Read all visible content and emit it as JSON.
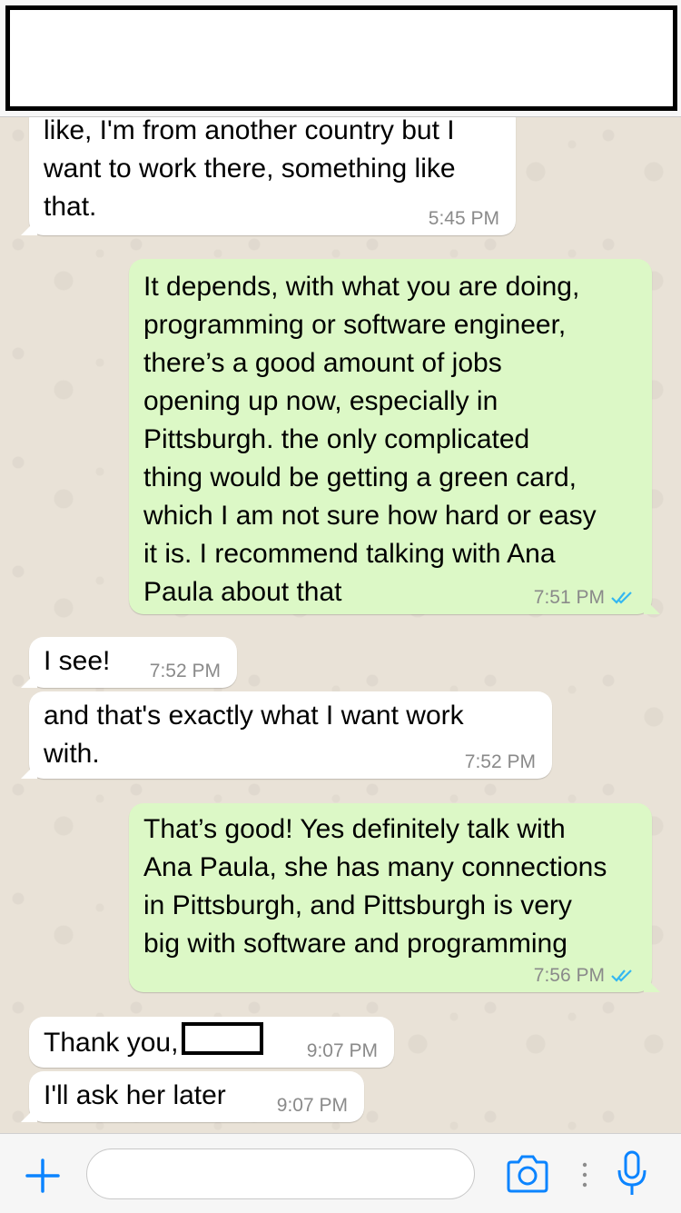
{
  "colors": {
    "accent": "#0b84ff",
    "incoming_bubble": "#ffffff",
    "outgoing_bubble": "#dcf8c6",
    "timestamp": "#8a8a8a",
    "read_ticks": "#34b7f1"
  },
  "messages": [
    {
      "direction": "incoming",
      "text": "like, I'm from another country but I\nwant to work there, something like\nthat.",
      "time": "5:45 PM"
    },
    {
      "direction": "outgoing",
      "text": "It depends, with what you are doing,\nprogramming or software engineer,\nthere’s a good amount of jobs\nopening up now, especially in\nPittsburgh. the only complicated\nthing would be getting a green card,\nwhich I am not sure how hard or easy\nit is. I recommend talking with Ana\nPaula about that",
      "time": "7:51 PM",
      "status": "read"
    },
    {
      "direction": "incoming",
      "text": "I see!",
      "time": "7:52 PM"
    },
    {
      "direction": "incoming",
      "text": "and that's exactly what I want work\nwith.",
      "time": "7:52 PM"
    },
    {
      "direction": "outgoing",
      "text": "That’s good! Yes definitely talk with\nAna Paula, she has many connections\nin Pittsburgh, and Pittsburgh is very\nbig with software and programming",
      "time": "7:56 PM",
      "status": "read"
    },
    {
      "direction": "incoming",
      "text": "Thank you,",
      "time": "9:07 PM",
      "redacted_name": true
    },
    {
      "direction": "incoming",
      "text": "I'll ask her later",
      "time": "9:07 PM"
    }
  ],
  "composer": {
    "input_value": "",
    "icons": [
      "plus-icon",
      "camera-icon",
      "more-dots-icon",
      "microphone-icon"
    ]
  }
}
